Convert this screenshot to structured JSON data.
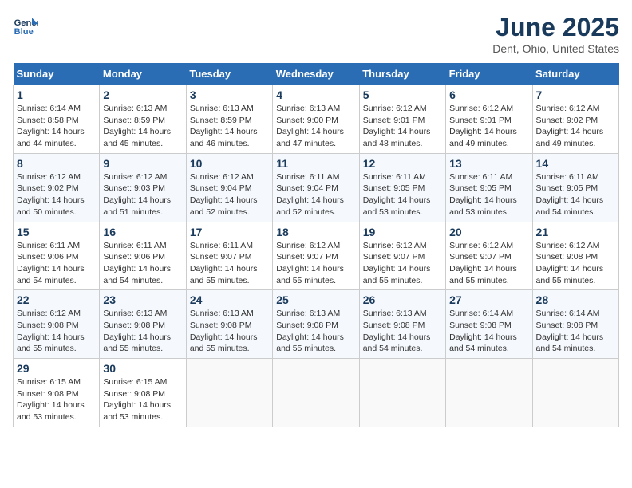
{
  "header": {
    "logo_line1": "General",
    "logo_line2": "Blue",
    "title": "June 2025",
    "subtitle": "Dent, Ohio, United States"
  },
  "weekdays": [
    "Sunday",
    "Monday",
    "Tuesday",
    "Wednesday",
    "Thursday",
    "Friday",
    "Saturday"
  ],
  "weeks": [
    [
      {
        "day": "1",
        "sunrise": "Sunrise: 6:14 AM",
        "sunset": "Sunset: 8:58 PM",
        "daylight": "Daylight: 14 hours and 44 minutes."
      },
      {
        "day": "2",
        "sunrise": "Sunrise: 6:13 AM",
        "sunset": "Sunset: 8:59 PM",
        "daylight": "Daylight: 14 hours and 45 minutes."
      },
      {
        "day": "3",
        "sunrise": "Sunrise: 6:13 AM",
        "sunset": "Sunset: 8:59 PM",
        "daylight": "Daylight: 14 hours and 46 minutes."
      },
      {
        "day": "4",
        "sunrise": "Sunrise: 6:13 AM",
        "sunset": "Sunset: 9:00 PM",
        "daylight": "Daylight: 14 hours and 47 minutes."
      },
      {
        "day": "5",
        "sunrise": "Sunrise: 6:12 AM",
        "sunset": "Sunset: 9:01 PM",
        "daylight": "Daylight: 14 hours and 48 minutes."
      },
      {
        "day": "6",
        "sunrise": "Sunrise: 6:12 AM",
        "sunset": "Sunset: 9:01 PM",
        "daylight": "Daylight: 14 hours and 49 minutes."
      },
      {
        "day": "7",
        "sunrise": "Sunrise: 6:12 AM",
        "sunset": "Sunset: 9:02 PM",
        "daylight": "Daylight: 14 hours and 49 minutes."
      }
    ],
    [
      {
        "day": "8",
        "sunrise": "Sunrise: 6:12 AM",
        "sunset": "Sunset: 9:02 PM",
        "daylight": "Daylight: 14 hours and 50 minutes."
      },
      {
        "day": "9",
        "sunrise": "Sunrise: 6:12 AM",
        "sunset": "Sunset: 9:03 PM",
        "daylight": "Daylight: 14 hours and 51 minutes."
      },
      {
        "day": "10",
        "sunrise": "Sunrise: 6:12 AM",
        "sunset": "Sunset: 9:04 PM",
        "daylight": "Daylight: 14 hours and 52 minutes."
      },
      {
        "day": "11",
        "sunrise": "Sunrise: 6:11 AM",
        "sunset": "Sunset: 9:04 PM",
        "daylight": "Daylight: 14 hours and 52 minutes."
      },
      {
        "day": "12",
        "sunrise": "Sunrise: 6:11 AM",
        "sunset": "Sunset: 9:05 PM",
        "daylight": "Daylight: 14 hours and 53 minutes."
      },
      {
        "day": "13",
        "sunrise": "Sunrise: 6:11 AM",
        "sunset": "Sunset: 9:05 PM",
        "daylight": "Daylight: 14 hours and 53 minutes."
      },
      {
        "day": "14",
        "sunrise": "Sunrise: 6:11 AM",
        "sunset": "Sunset: 9:05 PM",
        "daylight": "Daylight: 14 hours and 54 minutes."
      }
    ],
    [
      {
        "day": "15",
        "sunrise": "Sunrise: 6:11 AM",
        "sunset": "Sunset: 9:06 PM",
        "daylight": "Daylight: 14 hours and 54 minutes."
      },
      {
        "day": "16",
        "sunrise": "Sunrise: 6:11 AM",
        "sunset": "Sunset: 9:06 PM",
        "daylight": "Daylight: 14 hours and 54 minutes."
      },
      {
        "day": "17",
        "sunrise": "Sunrise: 6:11 AM",
        "sunset": "Sunset: 9:07 PM",
        "daylight": "Daylight: 14 hours and 55 minutes."
      },
      {
        "day": "18",
        "sunrise": "Sunrise: 6:12 AM",
        "sunset": "Sunset: 9:07 PM",
        "daylight": "Daylight: 14 hours and 55 minutes."
      },
      {
        "day": "19",
        "sunrise": "Sunrise: 6:12 AM",
        "sunset": "Sunset: 9:07 PM",
        "daylight": "Daylight: 14 hours and 55 minutes."
      },
      {
        "day": "20",
        "sunrise": "Sunrise: 6:12 AM",
        "sunset": "Sunset: 9:07 PM",
        "daylight": "Daylight: 14 hours and 55 minutes."
      },
      {
        "day": "21",
        "sunrise": "Sunrise: 6:12 AM",
        "sunset": "Sunset: 9:08 PM",
        "daylight": "Daylight: 14 hours and 55 minutes."
      }
    ],
    [
      {
        "day": "22",
        "sunrise": "Sunrise: 6:12 AM",
        "sunset": "Sunset: 9:08 PM",
        "daylight": "Daylight: 14 hours and 55 minutes."
      },
      {
        "day": "23",
        "sunrise": "Sunrise: 6:13 AM",
        "sunset": "Sunset: 9:08 PM",
        "daylight": "Daylight: 14 hours and 55 minutes."
      },
      {
        "day": "24",
        "sunrise": "Sunrise: 6:13 AM",
        "sunset": "Sunset: 9:08 PM",
        "daylight": "Daylight: 14 hours and 55 minutes."
      },
      {
        "day": "25",
        "sunrise": "Sunrise: 6:13 AM",
        "sunset": "Sunset: 9:08 PM",
        "daylight": "Daylight: 14 hours and 55 minutes."
      },
      {
        "day": "26",
        "sunrise": "Sunrise: 6:13 AM",
        "sunset": "Sunset: 9:08 PM",
        "daylight": "Daylight: 14 hours and 54 minutes."
      },
      {
        "day": "27",
        "sunrise": "Sunrise: 6:14 AM",
        "sunset": "Sunset: 9:08 PM",
        "daylight": "Daylight: 14 hours and 54 minutes."
      },
      {
        "day": "28",
        "sunrise": "Sunrise: 6:14 AM",
        "sunset": "Sunset: 9:08 PM",
        "daylight": "Daylight: 14 hours and 54 minutes."
      }
    ],
    [
      {
        "day": "29",
        "sunrise": "Sunrise: 6:15 AM",
        "sunset": "Sunset: 9:08 PM",
        "daylight": "Daylight: 14 hours and 53 minutes."
      },
      {
        "day": "30",
        "sunrise": "Sunrise: 6:15 AM",
        "sunset": "Sunset: 9:08 PM",
        "daylight": "Daylight: 14 hours and 53 minutes."
      },
      null,
      null,
      null,
      null,
      null
    ]
  ]
}
